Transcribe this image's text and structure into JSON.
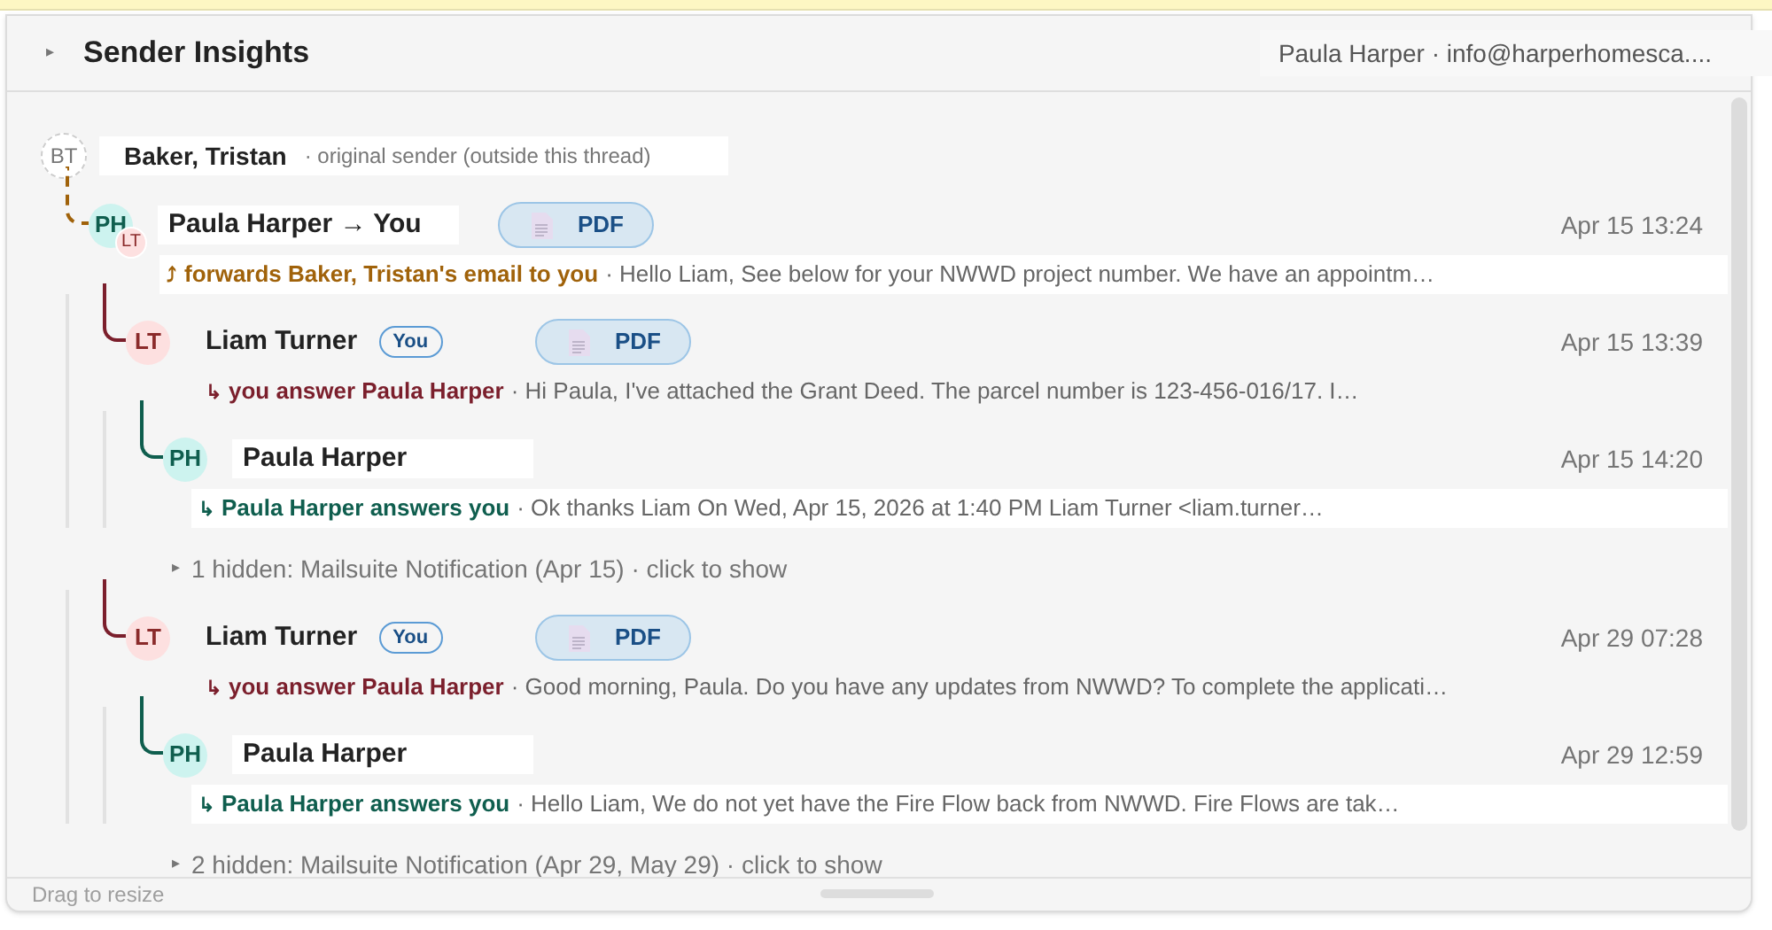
{
  "panel": {
    "toggle": "▸",
    "expanded": false,
    "title": "Sender Insights",
    "contact": "Paula Harper · info@harperhomesca...."
  },
  "thread": {
    "origin": {
      "initials": "BT",
      "name": "Baker, Tristan",
      "note": "· original sender (outside this thread)"
    },
    "messages": [
      {
        "kind": "forward",
        "initials": "PH",
        "badge_initials": "LT",
        "name": "Paula Harper → You",
        "attachment": "PDF",
        "date": "Apr 15 13:24",
        "arrow": "⤴",
        "action": "forwards Baker, Tristan's email to you",
        "preview": "· Hello Liam, See below for your NWWD project number. We have an appointm…",
        "children": [
          {
            "kind": "sent",
            "initials": "LT",
            "name": "Liam Turner",
            "tag": "You",
            "attachment": "PDF",
            "date": "Apr 15 13:39",
            "arrow": "↳",
            "action": "you answer Paula Harper",
            "preview": "· Hi Paula, I've attached the Grant Deed. The parcel number is 123-456-016/17. I…",
            "children": [
              {
                "kind": "received",
                "initials": "PH",
                "name": "Paula Harper",
                "date": "Apr 15 14:20",
                "arrow": "↳",
                "action": "Paula Harper answers you",
                "preview": "· Ok thanks Liam On Wed, Apr 15, 2026 at 1:40 PM Liam Turner <liam.turner…"
              }
            ]
          },
          {
            "kind": "hidden",
            "toggle": "▸",
            "text": "1 hidden: Mailsuite Notification (Apr 15) · click to show"
          },
          {
            "kind": "sent",
            "initials": "LT",
            "name": "Liam Turner",
            "tag": "You",
            "attachment": "PDF",
            "date": "Apr 29 07:28",
            "arrow": "↳",
            "action": "you answer Paula Harper",
            "preview": "· Good morning, Paula. Do you have any updates from NWWD? To complete the applicati…",
            "children": [
              {
                "kind": "received",
                "initials": "PH",
                "name": "Paula Harper",
                "date": "Apr 29 12:59",
                "arrow": "↳",
                "action": "Paula Harper answers you",
                "preview": "· Hello Liam, We do not yet have the Fire Flow back from NWWD. Fire Flows are tak…"
              }
            ]
          },
          {
            "kind": "hidden",
            "toggle": "▸",
            "text": "2 hidden: Mailsuite Notification (Apr 29, May 29) · click to show"
          }
        ]
      }
    ]
  },
  "footer": {
    "hint": "Drag to resize"
  }
}
